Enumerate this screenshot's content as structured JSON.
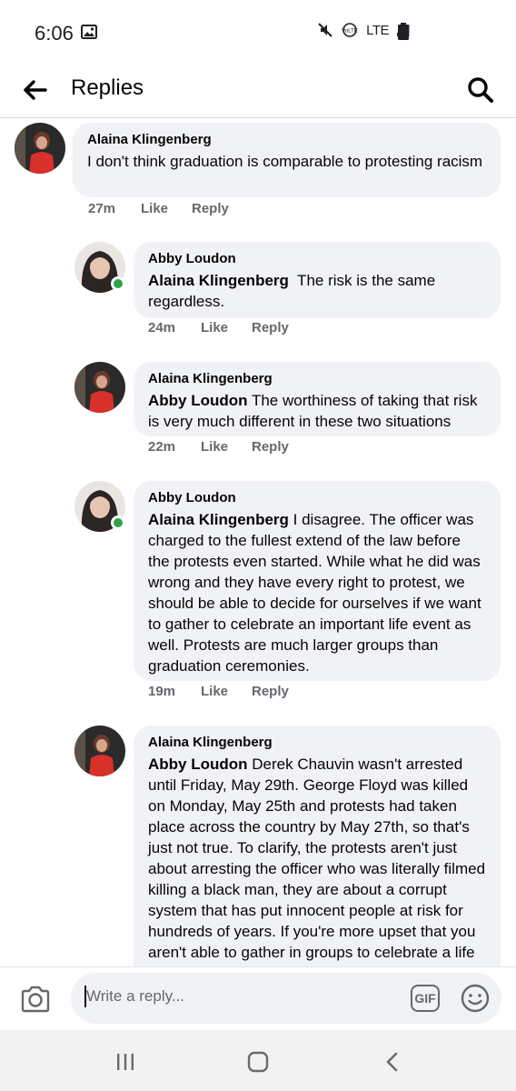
{
  "status_bar": {
    "time": "6:06",
    "network": "LTE",
    "icons": [
      "image-icon",
      "mute-icon",
      "volte-icon",
      "signal-icon",
      "battery-icon"
    ]
  },
  "header": {
    "title": "Replies",
    "back_icon": "back-arrow-icon",
    "search_icon": "search-icon"
  },
  "comments": [
    {
      "author": "Alaina Klingenberg",
      "mention": "",
      "body": "I don't think graduation is comparable to protesting racism",
      "time": "27m",
      "like": "Like",
      "reply": "Reply"
    },
    {
      "author": "Abby Loudon",
      "mention": "Alaina Klingenberg",
      "body": "  The risk is the same regardless.",
      "time": "24m",
      "like": "Like",
      "reply": "Reply"
    },
    {
      "author": "Alaina Klingenberg",
      "mention": "Abby Loudon",
      "body": " The worthiness of taking that risk is very much different in these two situations",
      "time": "22m",
      "like": "Like",
      "reply": "Reply"
    },
    {
      "author": "Abby Loudon",
      "mention": "Alaina Klingenberg",
      "body": " I disagree. The officer was charged to the fullest extend of the law before the protests even started. While what he did was wrong and they have every right to protest, we should be able to decide for ourselves if we want to gather to celebrate an important life event as well. Protests are much larger groups than graduation ceremonies.",
      "time": "19m",
      "like": "Like",
      "reply": "Reply"
    },
    {
      "author": "Alaina Klingenberg",
      "mention": "Abby Loudon",
      "body": " Derek Chauvin wasn't arrested until Friday, May 29th. George Floyd was killed on Monday, May 25th and protests had taken place across the country by May 27th, so that's just not true. To clarify, the protests aren't just about arresting the officer who was literally filmed killing a black man, they are about a corrupt system that has put innocent people at risk for hundreds of years. If you're more upset that you aren't able to gather in groups to celebrate a life event than you are about"
    }
  ],
  "composer": {
    "placeholder": "Write a reply...",
    "gif_label": "GIF"
  },
  "colors": {
    "bubble": "#f0f2f5",
    "meta_text": "#65676b",
    "online": "#31a24c"
  }
}
